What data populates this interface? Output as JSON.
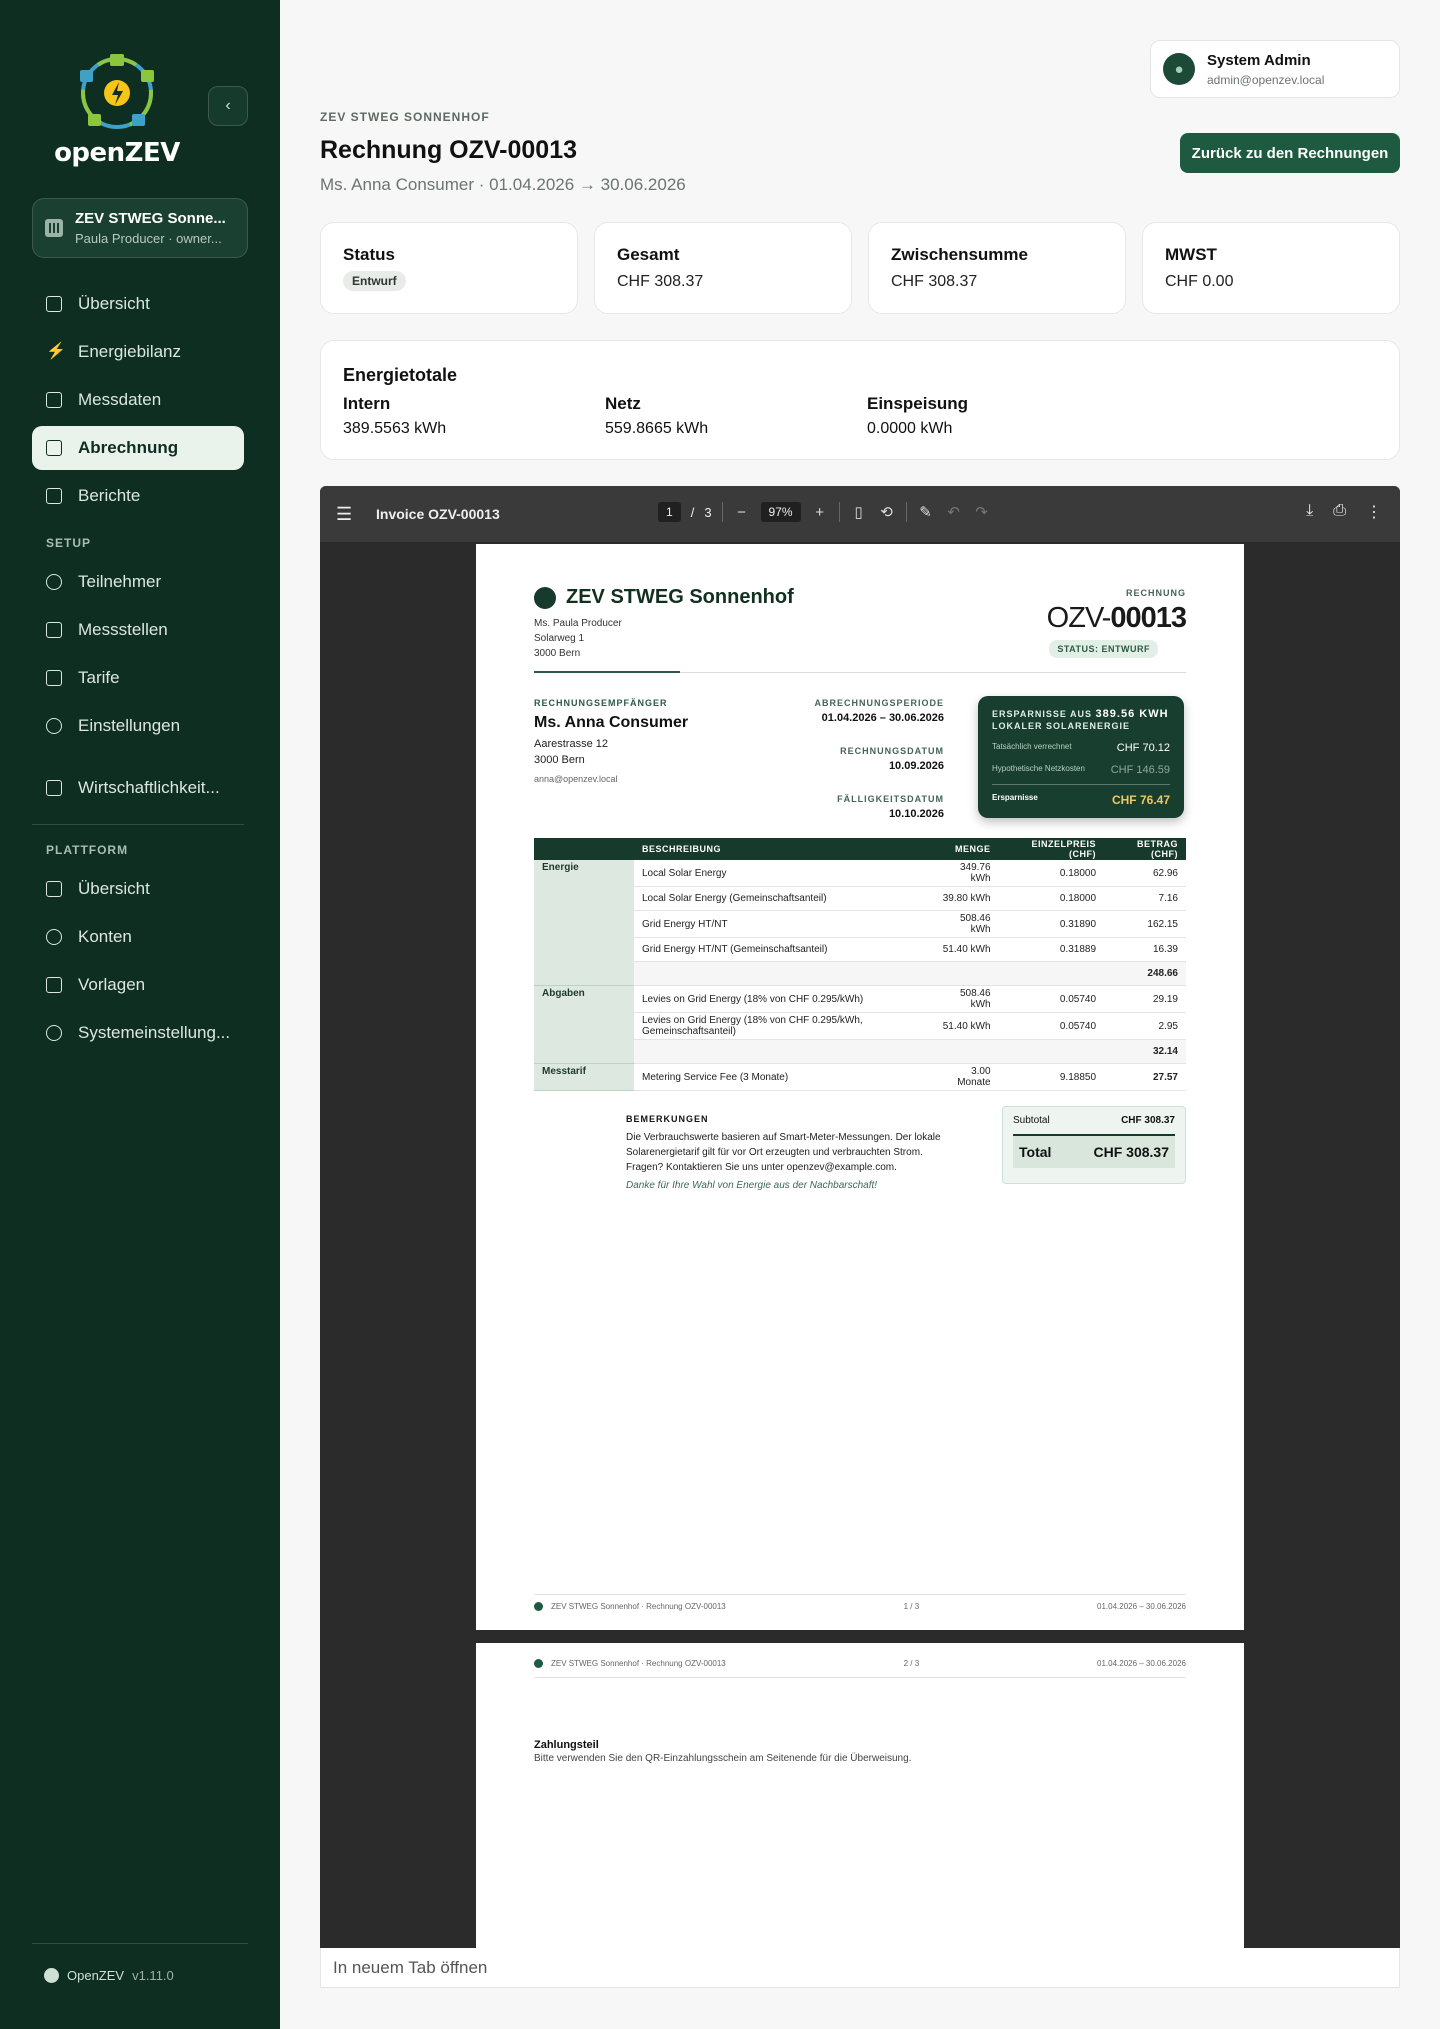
{
  "sidebar": {
    "brand": "openZEV",
    "org": {
      "name": "ZEV STWEG Sonnenhof",
      "name_display": "ZEV STWEG Sonne...",
      "sub": "Paula Producer · owner..."
    },
    "items": [
      {
        "label": "Übersicht",
        "icon": "home-icon"
      },
      {
        "label": "Energiebilanz",
        "icon": "bolt-icon"
      },
      {
        "label": "Messdaten",
        "icon": "chart-icon"
      },
      {
        "label": "Abrechnung",
        "icon": "invoice-icon",
        "active": true
      },
      {
        "label": "Berichte",
        "icon": "report-icon"
      }
    ],
    "setup_label": "SETUP",
    "setup_items": [
      {
        "label": "Teilnehmer",
        "icon": "user-icon"
      },
      {
        "label": "Messstellen",
        "icon": "meter-icon"
      },
      {
        "label": "Tarife",
        "icon": "tag-icon"
      },
      {
        "label": "Einstellungen",
        "icon": "gear-icon"
      }
    ],
    "extra_item": {
      "label": "Wirtschaftlichkeit...",
      "icon": "calculator-icon"
    },
    "platform_label": "PLATTFORM",
    "platform_items": [
      {
        "label": "Übersicht",
        "icon": "dashboard-icon"
      },
      {
        "label": "Konten",
        "icon": "user-icon"
      },
      {
        "label": "Vorlagen",
        "icon": "template-icon"
      },
      {
        "label": "Systemeinstellung...",
        "icon": "gear-icon"
      }
    ],
    "footer": {
      "name": "OpenZEV",
      "version": "v1.11.0"
    }
  },
  "user": {
    "name": "System Admin",
    "email": "admin@openzev.local"
  },
  "header": {
    "breadcrumb": "ZEV STWEG SONNENHOF",
    "title": "Rechnung OZV-00013",
    "subtitle": "Ms. Anna Consumer · 01.04.2026 → 30.06.2026",
    "back_button": "Zurück zu den Rechnungen"
  },
  "stats": [
    {
      "label": "Status",
      "badge": "Entwurf"
    },
    {
      "label": "Gesamt",
      "value": "CHF 308.37"
    },
    {
      "label": "Zwischensumme",
      "value": "CHF 308.37"
    },
    {
      "label": "MWST",
      "value": "CHF 0.00"
    }
  ],
  "energy": {
    "title": "Energietotale",
    "cols": [
      {
        "label": "Intern",
        "value": "389.5563 kWh"
      },
      {
        "label": "Netz",
        "value": "559.8665 kWh"
      },
      {
        "label": "Einspeisung",
        "value": "0.0000 kWh"
      }
    ]
  },
  "viewer": {
    "title": "Invoice OZV-00013",
    "page": "1",
    "page_sep": "/",
    "pages": "3",
    "zoom": "97%",
    "open_tab": "In neuem Tab öffnen"
  },
  "invoice": {
    "org": "ZEV STWEG Sonnenhof",
    "org_addr": [
      "Ms. Paula Producer",
      "Solarweg 1",
      "3000 Bern"
    ],
    "kind": "RECHNUNG",
    "num_prefix": "OZV-",
    "num_bold": "00013",
    "status": "STATUS: ENTWURF",
    "recipient_label": "RECHNUNGSEMPFÄNGER",
    "recipient_name": "Ms. Anna Consumer",
    "recipient_addr": [
      "Aarestrasse 12",
      "3000 Bern"
    ],
    "recipient_mail": "anna@openzev.local",
    "meta": [
      {
        "k": "ABRECHNUNGSPERIODE",
        "v": "01.04.2026 – 30.06.2026"
      },
      {
        "k": "RECHNUNGSDATUM",
        "v": "10.09.2026"
      },
      {
        "k": "FÄLLIGKEITSDATUM",
        "v": "10.10.2026"
      }
    ],
    "savings": {
      "head1": "ERSPARNISSE AUS",
      "kwh": "389.56 KWH",
      "head2": "LOKALER SOLARENERGIE",
      "rows": [
        {
          "k": "Tatsächlich verrechnet",
          "v": "CHF 70.12"
        },
        {
          "k": "Hypothetische Netzkosten",
          "v": "CHF 146.59"
        }
      ],
      "total_k": "Ersparnisse",
      "total_v": "CHF 76.47"
    },
    "columns": [
      "BESCHREIBUNG",
      "MENGE",
      "EINZELPREIS (CHF)",
      "BETRAG (CHF)"
    ],
    "groups": [
      {
        "name": "Energie",
        "rows": [
          [
            "Local Solar Energy",
            "349.76 kWh",
            "0.18000",
            "62.96"
          ],
          [
            "Local Solar Energy (Gemeinschaftsanteil)",
            "39.80 kWh",
            "0.18000",
            "7.16"
          ],
          [
            "Grid Energy HT/NT",
            "508.46 kWh",
            "0.31890",
            "162.15"
          ],
          [
            "Grid Energy HT/NT (Gemeinschaftsanteil)",
            "51.40 kWh",
            "0.31889",
            "16.39"
          ]
        ],
        "subtotal": "248.66"
      },
      {
        "name": "Abgaben",
        "rows": [
          [
            "Levies on Grid Energy (18% von CHF 0.295/kWh)",
            "508.46 kWh",
            "0.05740",
            "29.19"
          ],
          [
            "Levies on Grid Energy (18% von CHF 0.295/kWh, Gemeinschaftsanteil)",
            "51.40 kWh",
            "0.05740",
            "2.95"
          ]
        ],
        "subtotal": "32.14"
      },
      {
        "name": "Messtarif",
        "rows": [
          [
            "Metering Service Fee (3 Monate)",
            "3.00 Monate",
            "9.18850",
            "27.57"
          ]
        ]
      }
    ],
    "remarks_label": "BEMERKUNGEN",
    "remarks": "Die Verbrauchswerte basieren auf Smart-Meter-Messungen. Der lokale Solarenergietarif gilt für vor Ort erzeugten und verbrauchten Strom. Fragen? Kontaktieren Sie uns unter openzev@example.com.",
    "thanks": "Danke für Ihre Wahl von Energie aus der Nachbarschaft!",
    "subtotal_label": "Subtotal",
    "subtotal": "CHF 308.37",
    "total_label": "Total",
    "total": "CHF 308.37",
    "footer_left": "ZEV STWEG Sonnenhof · Rechnung OZV-00013",
    "footer_page1": "1 / 3",
    "footer_page2": "2 / 3",
    "footer_right": "01.04.2026 – 30.06.2026",
    "payment_title": "Zahlungsteil",
    "payment_text": "Bitte verwenden Sie den QR-Einzahlungsschein am Seitenende für die Überweisung."
  }
}
